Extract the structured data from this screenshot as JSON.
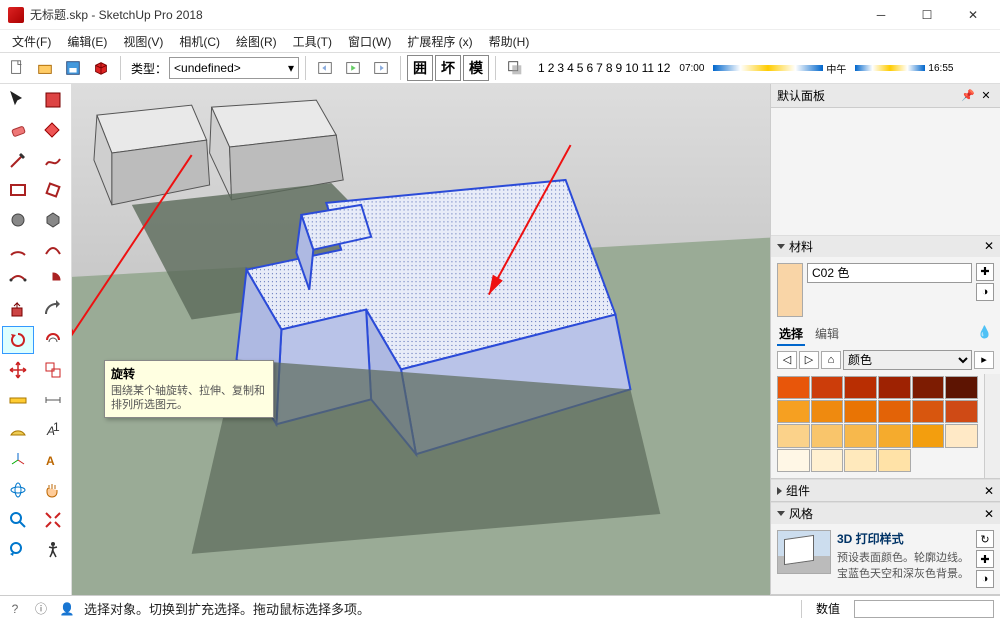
{
  "window": {
    "title": "无标题.skp - SketchUp Pro 2018"
  },
  "menu": {
    "items": [
      "文件(F)",
      "编辑(E)",
      "视图(V)",
      "相机(C)",
      "绘图(R)",
      "工具(T)",
      "窗口(W)",
      "扩展程序 (x)",
      "帮助(H)"
    ]
  },
  "toolbar": {
    "type_label": "类型：",
    "type_value": "<undefined>",
    "sq_chars": [
      "囲",
      "坏",
      "模"
    ],
    "time_nums": [
      "1",
      "2",
      "3",
      "4",
      "5",
      "6",
      "7",
      "8",
      "9",
      "10",
      "11",
      "12"
    ],
    "time_left": "07:00",
    "time_mid": "中午",
    "time_right": "16:55"
  },
  "tooltip": {
    "title": "旋转",
    "desc": "围绕某个轴旋转、拉伸、复制和排列所选图元。"
  },
  "panel": {
    "default_panel": "默认面板",
    "materials": {
      "header": "材料",
      "name": "C02 色",
      "tabs": [
        "选择",
        "编辑"
      ],
      "active_tab": 0,
      "category": "颜色"
    },
    "swatches": [
      "#e8560a",
      "#cc3d0a",
      "#b92e02",
      "#9e2202",
      "#7d1c02",
      "#5d1402",
      "#f6a021",
      "#ef8a0f",
      "#e97404",
      "#e36307",
      "#d8560e",
      "#cf4a15",
      "#fbd28a",
      "#f9c56b",
      "#f7b84c",
      "#f5ab2d",
      "#f39e0e",
      "#ffe9c6",
      "#fff7e6",
      "#fff0d1",
      "#ffe9bc",
      "#ffe2a7"
    ],
    "components": {
      "header": "组件"
    },
    "styles": {
      "header": "风格",
      "name": "3D 打印样式",
      "desc": "预设表面颜色。轮廓边线。宝蓝色天空和深灰色背景。"
    }
  },
  "status": {
    "msg": "选择对象。切换到扩充选择。拖动鼠标选择多项。",
    "value_label": "数值"
  }
}
